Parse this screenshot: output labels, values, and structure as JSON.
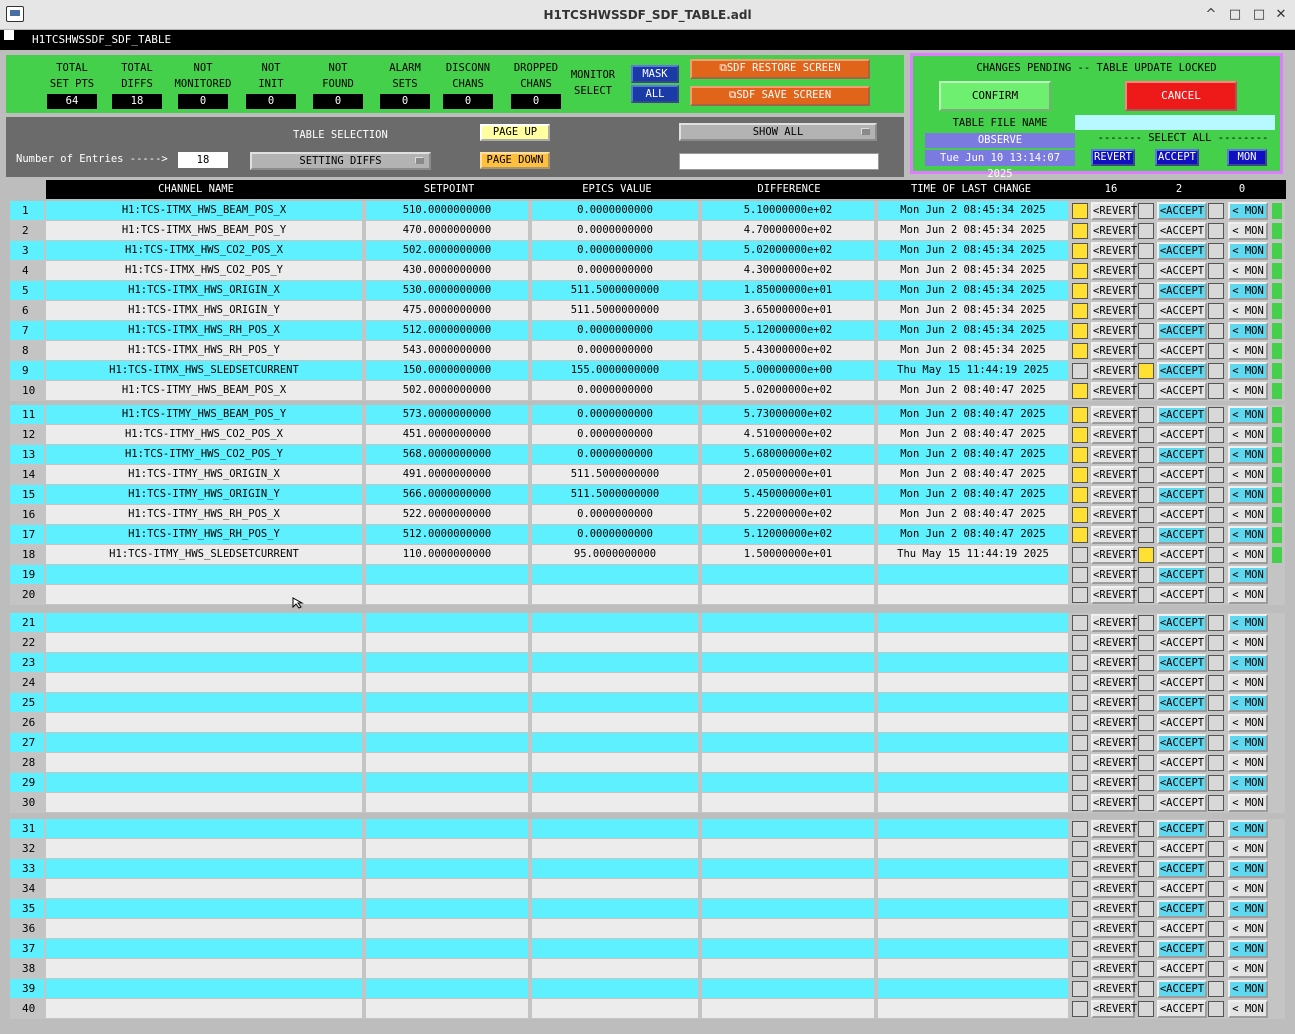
{
  "window": {
    "title": "H1TCSHWSSDF_SDF_TABLE.adl",
    "sub": "H1TCSHWSSDF_SDF_TABLE",
    "min": "^",
    "max": "□",
    "close": "✕"
  },
  "stats": [
    {
      "l1": "TOTAL",
      "l2": "SET PTS",
      "v": "64"
    },
    {
      "l1": "TOTAL",
      "l2": "DIFFS",
      "v": "18"
    },
    {
      "l1": "NOT",
      "l2": "MONITORED",
      "v": "0"
    },
    {
      "l1": "NOT",
      "l2": "INIT",
      "v": "0"
    },
    {
      "l1": "NOT",
      "l2": "FOUND",
      "v": "0"
    },
    {
      "l1": "ALARM",
      "l2": "SETS",
      "v": "0"
    },
    {
      "l1": "DISCONN",
      "l2": "CHANS",
      "v": "0"
    },
    {
      "l1": "DROPPED",
      "l2": "CHANS",
      "v": "0"
    }
  ],
  "monitor": {
    "l1": "MONITOR",
    "l2": "SELECT",
    "mask": "MASK",
    "all": "ALL"
  },
  "restore": "⧉SDF RESTORE SCREEN",
  "save": "⧉SDF SAVE SCREEN",
  "pending": {
    "title": "CHANGES PENDING -- TABLE UPDATE LOCKED",
    "confirm": "CONFIRM",
    "cancel": "CANCEL",
    "file_label": "TABLE FILE NAME",
    "file_value": "",
    "observe": "OBSERVE",
    "date": "Tue Jun 10 13:14:07 2025",
    "select_all": "------- SELECT ALL --------",
    "revert": "REVERT",
    "accept": "ACCEPT",
    "mon": "MON"
  },
  "selection": {
    "label": "TABLE SELECTION",
    "entries_label": "Number of Entries ----->",
    "entries": "18",
    "menu": "SETTING DIFFS",
    "page_up": "PAGE UP",
    "page_down": "PAGE DOWN",
    "show": "SHOW ALL",
    "filter": ""
  },
  "headers": {
    "name": "CHANNEL NAME",
    "setpoint": "SETPOINT",
    "epics": "EPICS VALUE",
    "diff": "DIFFERENCE",
    "time": "TIME OF LAST CHANGE",
    "c1": "16",
    "c2": "2",
    "c3": "0"
  },
  "btn": {
    "revert": "<REVERT",
    "accept": "<ACCEPT",
    "mon": "< MON"
  },
  "rows": [
    {
      "n": "1",
      "name": "H1:TCS-ITMX_HWS_BEAM_POS_X",
      "sp": "510.0000000000",
      "ev": "0.0000000000",
      "df": "5.10000000e+02",
      "t": "Mon Jun  2 08:45:34 2025",
      "y1": true,
      "y2": false,
      "gm": true
    },
    {
      "n": "2",
      "name": "H1:TCS-ITMX_HWS_BEAM_POS_Y",
      "sp": "470.0000000000",
      "ev": "0.0000000000",
      "df": "4.70000000e+02",
      "t": "Mon Jun  2 08:45:34 2025",
      "y1": true,
      "y2": false,
      "gm": true
    },
    {
      "n": "3",
      "name": "H1:TCS-ITMX_HWS_CO2_POS_X",
      "sp": "502.0000000000",
      "ev": "0.0000000000",
      "df": "5.02000000e+02",
      "t": "Mon Jun  2 08:45:34 2025",
      "y1": true,
      "y2": false,
      "gm": true
    },
    {
      "n": "4",
      "name": "H1:TCS-ITMX_HWS_CO2_POS_Y",
      "sp": "430.0000000000",
      "ev": "0.0000000000",
      "df": "4.30000000e+02",
      "t": "Mon Jun  2 08:45:34 2025",
      "y1": true,
      "y2": false,
      "gm": true
    },
    {
      "n": "5",
      "name": "H1:TCS-ITMX_HWS_ORIGIN_X",
      "sp": "530.0000000000",
      "ev": "511.5000000000",
      "df": "1.85000000e+01",
      "t": "Mon Jun  2 08:45:34 2025",
      "y1": true,
      "y2": false,
      "gm": true
    },
    {
      "n": "6",
      "name": "H1:TCS-ITMX_HWS_ORIGIN_Y",
      "sp": "475.0000000000",
      "ev": "511.5000000000",
      "df": "3.65000000e+01",
      "t": "Mon Jun  2 08:45:34 2025",
      "y1": true,
      "y2": false,
      "gm": true
    },
    {
      "n": "7",
      "name": "H1:TCS-ITMX_HWS_RH_POS_X",
      "sp": "512.0000000000",
      "ev": "0.0000000000",
      "df": "5.12000000e+02",
      "t": "Mon Jun  2 08:45:34 2025",
      "y1": true,
      "y2": false,
      "gm": true
    },
    {
      "n": "8",
      "name": "H1:TCS-ITMX_HWS_RH_POS_Y",
      "sp": "543.0000000000",
      "ev": "0.0000000000",
      "df": "5.43000000e+02",
      "t": "Mon Jun  2 08:45:34 2025",
      "y1": true,
      "y2": false,
      "gm": true
    },
    {
      "n": "9",
      "name": "H1:TCS-ITMX_HWS_SLEDSETCURRENT",
      "sp": "150.0000000000",
      "ev": "155.0000000000",
      "df": "5.00000000e+00",
      "t": "Thu May 15 11:44:19 2025",
      "y1": false,
      "y2": true,
      "gm": true
    },
    {
      "n": "10",
      "name": "H1:TCS-ITMY_HWS_BEAM_POS_X",
      "sp": "502.0000000000",
      "ev": "0.0000000000",
      "df": "5.02000000e+02",
      "t": "Mon Jun  2 08:40:47 2025",
      "y1": true,
      "y2": false,
      "gm": true
    },
    {
      "n": "11",
      "name": "H1:TCS-ITMY_HWS_BEAM_POS_Y",
      "sp": "573.0000000000",
      "ev": "0.0000000000",
      "df": "5.73000000e+02",
      "t": "Mon Jun  2 08:40:47 2025",
      "y1": true,
      "y2": false,
      "gm": true
    },
    {
      "n": "12",
      "name": "H1:TCS-ITMY_HWS_CO2_POS_X",
      "sp": "451.0000000000",
      "ev": "0.0000000000",
      "df": "4.51000000e+02",
      "t": "Mon Jun  2 08:40:47 2025",
      "y1": true,
      "y2": false,
      "gm": true
    },
    {
      "n": "13",
      "name": "H1:TCS-ITMY_HWS_CO2_POS_Y",
      "sp": "568.0000000000",
      "ev": "0.0000000000",
      "df": "5.68000000e+02",
      "t": "Mon Jun  2 08:40:47 2025",
      "y1": true,
      "y2": false,
      "gm": true
    },
    {
      "n": "14",
      "name": "H1:TCS-ITMY_HWS_ORIGIN_X",
      "sp": "491.0000000000",
      "ev": "511.5000000000",
      "df": "2.05000000e+01",
      "t": "Mon Jun  2 08:40:47 2025",
      "y1": true,
      "y2": false,
      "gm": true
    },
    {
      "n": "15",
      "name": "H1:TCS-ITMY_HWS_ORIGIN_Y",
      "sp": "566.0000000000",
      "ev": "511.5000000000",
      "df": "5.45000000e+01",
      "t": "Mon Jun  2 08:40:47 2025",
      "y1": true,
      "y2": false,
      "gm": true
    },
    {
      "n": "16",
      "name": "H1:TCS-ITMY_HWS_RH_POS_X",
      "sp": "522.0000000000",
      "ev": "0.0000000000",
      "df": "5.22000000e+02",
      "t": "Mon Jun  2 08:40:47 2025",
      "y1": true,
      "y2": false,
      "gm": true
    },
    {
      "n": "17",
      "name": "H1:TCS-ITMY_HWS_RH_POS_Y",
      "sp": "512.0000000000",
      "ev": "0.0000000000",
      "df": "5.12000000e+02",
      "t": "Mon Jun  2 08:40:47 2025",
      "y1": true,
      "y2": false,
      "gm": true
    },
    {
      "n": "18",
      "name": "H1:TCS-ITMY_HWS_SLEDSETCURRENT",
      "sp": "110.0000000000",
      "ev": "95.0000000000",
      "df": "1.50000000e+01",
      "t": "Thu May 15 11:44:19 2025",
      "y1": false,
      "y2": true,
      "gm": true
    },
    {
      "n": "19"
    },
    {
      "n": "20"
    },
    {
      "n": "21"
    },
    {
      "n": "22"
    },
    {
      "n": "23"
    },
    {
      "n": "24"
    },
    {
      "n": "25"
    },
    {
      "n": "26"
    },
    {
      "n": "27"
    },
    {
      "n": "28"
    },
    {
      "n": "29"
    },
    {
      "n": "30"
    },
    {
      "n": "31"
    },
    {
      "n": "32"
    },
    {
      "n": "33"
    },
    {
      "n": "34"
    },
    {
      "n": "35"
    },
    {
      "n": "36"
    },
    {
      "n": "37"
    },
    {
      "n": "38"
    },
    {
      "n": "39"
    },
    {
      "n": "40"
    }
  ]
}
